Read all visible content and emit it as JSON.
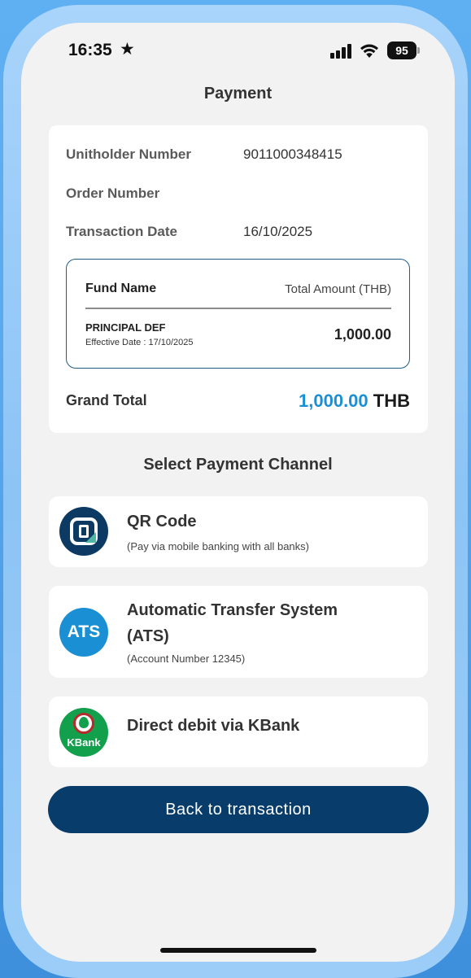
{
  "status_bar": {
    "time": "16:35",
    "battery": "95"
  },
  "header": {
    "title": "Payment"
  },
  "summary": {
    "rows": [
      {
        "label": "Unitholder Number",
        "value": "9011000348415"
      },
      {
        "label": "Order Number",
        "value": ""
      },
      {
        "label": "Transaction Date",
        "value": "16/10/2025"
      }
    ],
    "fund_table": {
      "col_fund": "Fund Name",
      "col_amount": "Total Amount (THB)",
      "fund_name": "PRINCIPAL DEF",
      "effective_date": "Effective Date : 17/10/2025",
      "amount": "1,000.00"
    },
    "grand_total": {
      "label": "Grand Total",
      "value": "1,000.00",
      "currency": "THB"
    }
  },
  "channels": {
    "heading": "Select Payment Channel",
    "items": [
      {
        "title": "QR Code",
        "title_line2": "",
        "subtitle": "(Pay via mobile banking with all banks)",
        "icon": "qr-payment-icon"
      },
      {
        "title": "Automatic Transfer System",
        "title_line2": "(ATS)",
        "subtitle": "(Account Number 12345)",
        "icon": "ats-icon",
        "icon_text": "ATS"
      },
      {
        "title": "Direct debit via KBank",
        "title_line2": "",
        "subtitle": "",
        "icon": "kbank-icon",
        "icon_text": "KBank"
      }
    ]
  },
  "actions": {
    "back_label": "Back to transaction"
  },
  "colors": {
    "primary": "#083c6b",
    "accent": "#1a8fd4",
    "kbank": "#13a04c"
  }
}
